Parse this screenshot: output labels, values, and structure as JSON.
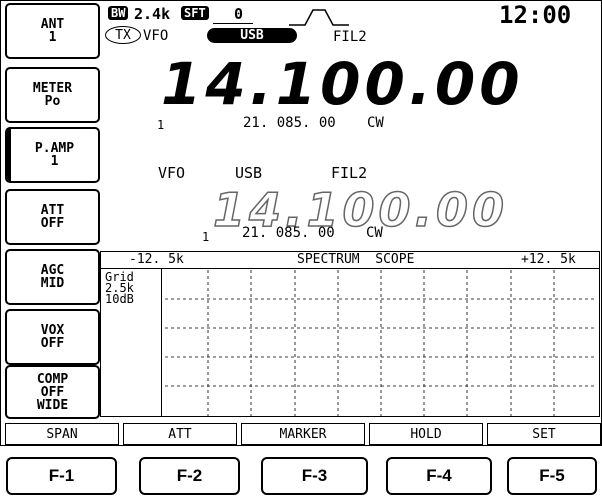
{
  "side_keys": [
    {
      "line1": "ANT",
      "line2": "1",
      "line3": ""
    },
    {
      "line1": "METER",
      "line2": "Po",
      "line3": ""
    },
    {
      "line1": "P.AMP",
      "line2": "1",
      "line3": ""
    },
    {
      "line1": "ATT",
      "line2": "OFF",
      "line3": ""
    },
    {
      "line1": "AGC",
      "line2": "MID",
      "line3": ""
    },
    {
      "line1": "VOX",
      "line2": "OFF",
      "line3": ""
    },
    {
      "line1": "COMP",
      "line2": "OFF",
      "line3": "WIDE"
    }
  ],
  "status": {
    "bw_badge": "BW",
    "bw_value": "2.4k",
    "sft_badge": "SFT",
    "sft_value": "0",
    "clock": "12:00"
  },
  "main_vfo": {
    "tx_badge": "TX",
    "vfo_label": "VFO",
    "mode": "USB",
    "filter": "FIL2",
    "frequency": "14.100.00",
    "memory_channel": "1",
    "sub_frequency": "21. 085. 00",
    "sub_mode": "CW"
  },
  "sub_vfo": {
    "vfo_label": "VFO",
    "mode": "USB",
    "filter": "FIL2",
    "frequency": "14.100.00",
    "memory_channel": "1",
    "sub_frequency": "21. 085. 00",
    "sub_mode": "CW"
  },
  "scope": {
    "left_freq": "-12. 5k",
    "title": "SPECTRUM  SCOPE",
    "right_freq": "+12. 5k",
    "grid_label1": "Grid",
    "grid_label2": "2.5k",
    "grid_label3": "10dB"
  },
  "function_labels": [
    "SPAN",
    "ATT",
    "MARKER",
    "HOLD",
    "SET"
  ],
  "hardware_keys": [
    "F-1",
    "F-2",
    "F-3",
    "F-4",
    "F-5"
  ]
}
